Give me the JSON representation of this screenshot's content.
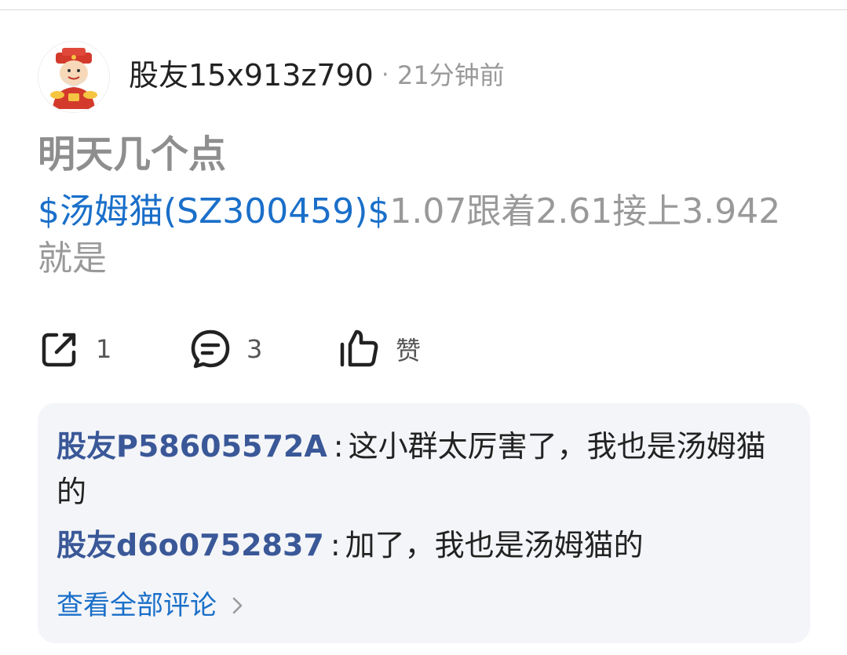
{
  "post": {
    "author": "股友15x913z790",
    "separator": "·",
    "time_ago": "21分钟前",
    "title": "明天几个点",
    "stock_link": "$汤姆猫(SZ300459)$",
    "body_rest": "1.07跟着2.61接上3.942就是",
    "actions": {
      "share_count": "1",
      "comment_count": "3",
      "like_label": "赞"
    }
  },
  "comments": {
    "items": [
      {
        "user": "股友P58605572A",
        "colon": ":",
        "text": "这小群太厉害了，我也是汤姆猫的"
      },
      {
        "user": "股友d6o0752837",
        "colon": ":",
        "text": "加了，我也是汤姆猫的"
      }
    ],
    "view_all": "查看全部评论"
  },
  "colors": {
    "link_blue": "#1a6fc9",
    "comment_name": "#3a5898",
    "comment_bg": "#f4f5f8"
  },
  "icons": [
    "avatar-god-of-wealth",
    "share-icon",
    "comment-icon",
    "thumbs-up-icon",
    "chevron-right-icon"
  ]
}
